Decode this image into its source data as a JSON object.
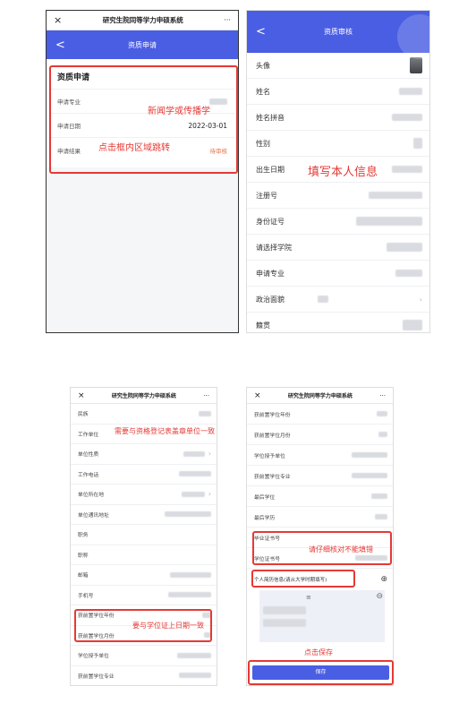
{
  "screen1": {
    "close": "×",
    "title": "研究生院同等学力申硕系统",
    "more": "···",
    "header_back": "<",
    "header_title": "资质申请",
    "card_title": "资质申请",
    "rows": [
      {
        "label": "申请专业",
        "value": ""
      },
      {
        "label": "申请日期",
        "value": "2022-03-01"
      },
      {
        "label": "申请结果",
        "value": "待审核"
      }
    ],
    "annot_major": "新闻学或传播学",
    "annot_jump": "点击框内区域跳转"
  },
  "screen2": {
    "back": "<",
    "title": "资质审核",
    "rows": [
      {
        "label": "头像"
      },
      {
        "label": "姓名"
      },
      {
        "label": "姓名拼音"
      },
      {
        "label": "性别"
      },
      {
        "label": "出生日期"
      },
      {
        "label": "注册号"
      },
      {
        "label": "身份证号"
      },
      {
        "label": "请选择学院"
      },
      {
        "label": "申请专业"
      },
      {
        "label": "政治面貌"
      },
      {
        "label": "籍贯"
      }
    ],
    "annot": "填写本人信息"
  },
  "screen3": {
    "close": "×",
    "title": "研究生院同等学力申硕系统",
    "more": "···",
    "rows": [
      {
        "label": "民族"
      },
      {
        "label": "工作单位"
      },
      {
        "label": "单位性质"
      },
      {
        "label": "工作电话"
      },
      {
        "label": "单位所在地"
      },
      {
        "label": "单位通讯地址"
      },
      {
        "label": "职务"
      },
      {
        "label": "职称"
      },
      {
        "label": "邮箱"
      },
      {
        "label": "手机号"
      },
      {
        "label": "获前置学位年份"
      },
      {
        "label": "获前置学位月份"
      },
      {
        "label": "学位授予单位"
      },
      {
        "label": "获前置学位专业"
      }
    ],
    "annot_unit": "需要与资格登记表盖章单位一致",
    "annot_date": "要与学位证上日期一致"
  },
  "screen4": {
    "close": "×",
    "title": "研究生院同等学力申硕系统",
    "more": "···",
    "rows": [
      {
        "label": "获前置学位年份"
      },
      {
        "label": "获前置学位月份"
      },
      {
        "label": "学位授予单位"
      },
      {
        "label": "获前置学位专业"
      },
      {
        "label": "最后学位"
      },
      {
        "label": "最后学历"
      },
      {
        "label": "毕业证书号"
      },
      {
        "label": "学位证书号"
      }
    ],
    "resume_label": "个人简历信息(请从大学时期填写)",
    "resume_mid": "≡",
    "annot_check": "请仔细核对不能填错",
    "annot_save": "点击保存",
    "save_label": "保存"
  },
  "colors": {
    "accent": "#4a5ee3",
    "annotation": "#e53935"
  }
}
